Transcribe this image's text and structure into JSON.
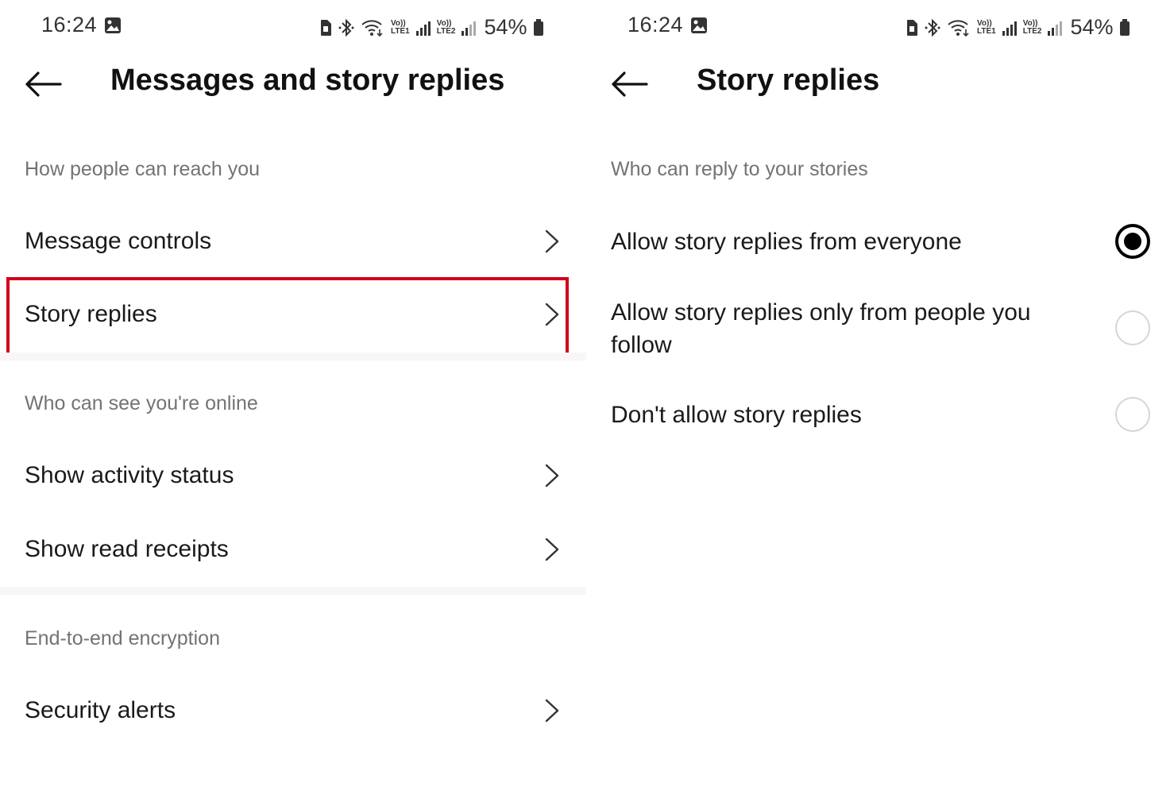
{
  "status_bar": {
    "time": "16:24",
    "battery": "54%",
    "net1_top": "Vo))",
    "net1_bottom": "LTE1",
    "net2_top": "Vo))",
    "net2_bottom": "LTE2",
    "icons": [
      "gallery-icon",
      "sim-icon",
      "bluetooth-icon",
      "wifi-icon",
      "signal-icon",
      "battery-icon"
    ]
  },
  "left": {
    "title": "Messages and story replies",
    "sections": [
      {
        "heading": "How people can reach you",
        "items": [
          {
            "label": "Message controls"
          },
          {
            "label": "Story replies",
            "highlighted": true
          }
        ]
      },
      {
        "heading": "Who can see you're online",
        "items": [
          {
            "label": "Show activity status"
          },
          {
            "label": "Show read receipts"
          }
        ]
      },
      {
        "heading": "End-to-end encryption",
        "items": [
          {
            "label": "Security alerts"
          }
        ]
      }
    ]
  },
  "right": {
    "title": "Story replies",
    "heading": "Who can reply to your stories",
    "options": [
      {
        "label": "Allow story replies from everyone",
        "selected": true
      },
      {
        "label": "Allow story replies only from people you follow",
        "selected": false
      },
      {
        "label": "Don't allow story replies",
        "selected": false
      }
    ]
  },
  "colors": {
    "highlight": "#d0021b",
    "section_heading": "#737373",
    "divider": "#f7f7f7",
    "radio_unselected": "#d6d6d6"
  }
}
